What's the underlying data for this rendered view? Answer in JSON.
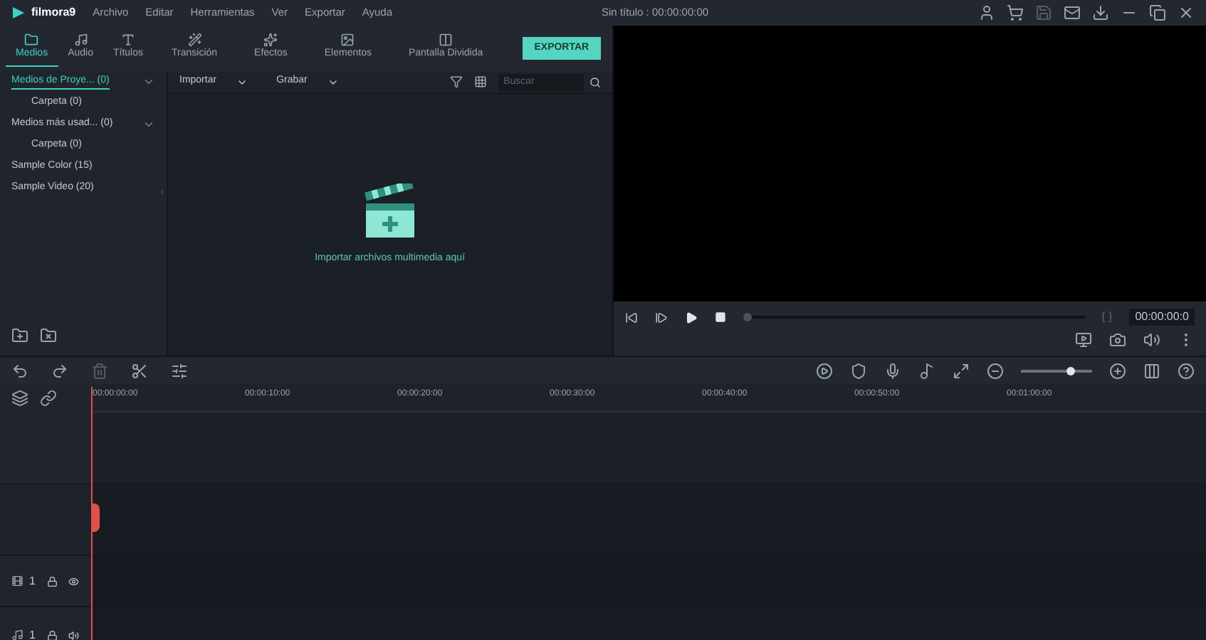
{
  "app": {
    "name": "filmora9"
  },
  "menu": [
    "Archivo",
    "Editar",
    "Herramientas",
    "Ver",
    "Exportar",
    "Ayuda"
  ],
  "window": {
    "title": "Sin título : 00:00:00:00"
  },
  "tabs": [
    {
      "label": "Medios",
      "selected": true,
      "kind": "folder"
    },
    {
      "label": "Audio",
      "selected": false,
      "kind": "note"
    },
    {
      "label": "Títulos",
      "selected": false,
      "kind": "text"
    },
    {
      "label": "Transición",
      "selected": false,
      "kind": "transition"
    },
    {
      "label": "Efectos",
      "selected": false,
      "kind": "effects"
    },
    {
      "label": "Elementos",
      "selected": false,
      "kind": "image"
    },
    {
      "label": "Pantalla Dividida",
      "selected": false,
      "kind": "split"
    }
  ],
  "export_button": "EXPORTAR",
  "toolbar": {
    "import": "Importar",
    "record": "Grabar",
    "search": {
      "placeholder": "Buscar"
    }
  },
  "sidebar": {
    "items": [
      {
        "label": "Medios de Proye... (0)",
        "selected": true,
        "expanded": true,
        "children": [
          {
            "label": "Carpeta (0)",
            "selected": false
          }
        ]
      },
      {
        "label": "Medios más usad... (0)",
        "selected": false,
        "expanded": true,
        "children": [
          {
            "label": "Carpeta (0)",
            "selected": false
          }
        ]
      },
      {
        "label": "Sample Color (15)",
        "selected": false
      },
      {
        "label": "Sample Video (20)",
        "selected": false
      }
    ]
  },
  "empty_state": "Importar archivos multimedia aquí",
  "preview": {
    "level": 0.0,
    "brackets": "{ }",
    "time": "00:00:00:0"
  },
  "timeline": {
    "zoom": {
      "level": 0.72
    },
    "ruler": [
      "00:00:00:00",
      "00:00:10:00",
      "00:00:20:00",
      "00:00:30:00",
      "00:00:40:00",
      "00:00:50:00",
      "00:01:00:00"
    ],
    "tracks": [
      {
        "kind": "video",
        "label": "1"
      },
      {
        "kind": "audio",
        "label": "1"
      }
    ]
  }
}
